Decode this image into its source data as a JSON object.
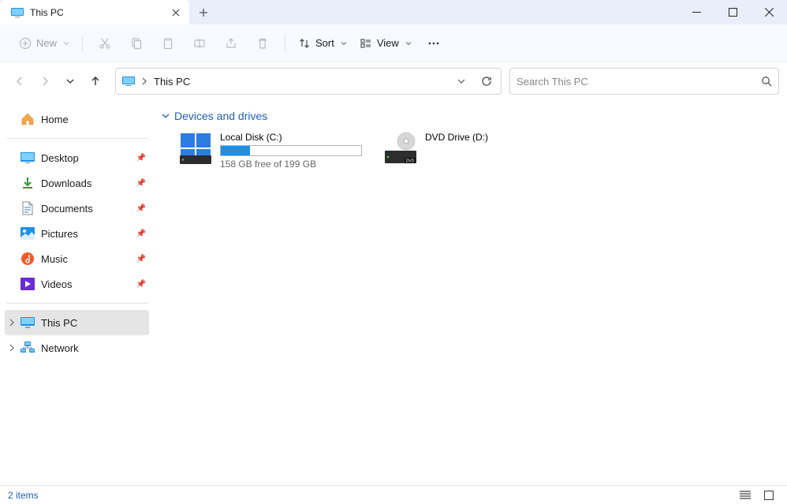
{
  "tab": {
    "title": "This PC"
  },
  "toolbar": {
    "new_label": "New",
    "sort_label": "Sort",
    "view_label": "View"
  },
  "address": {
    "crumb": "This PC"
  },
  "search": {
    "placeholder": "Search This PC"
  },
  "sidebar": {
    "home": "Home",
    "quick": [
      {
        "label": "Desktop"
      },
      {
        "label": "Downloads"
      },
      {
        "label": "Documents"
      },
      {
        "label": "Pictures"
      },
      {
        "label": "Music"
      },
      {
        "label": "Videos"
      }
    ],
    "thispc": "This PC",
    "network": "Network"
  },
  "content": {
    "group_title": "Devices and drives",
    "drives": [
      {
        "name": "Local Disk (C:)",
        "free_text": "158 GB free of 199 GB",
        "used_pct": 21
      },
      {
        "name": "DVD Drive (D:)"
      }
    ]
  },
  "status": {
    "items": "2 items"
  }
}
